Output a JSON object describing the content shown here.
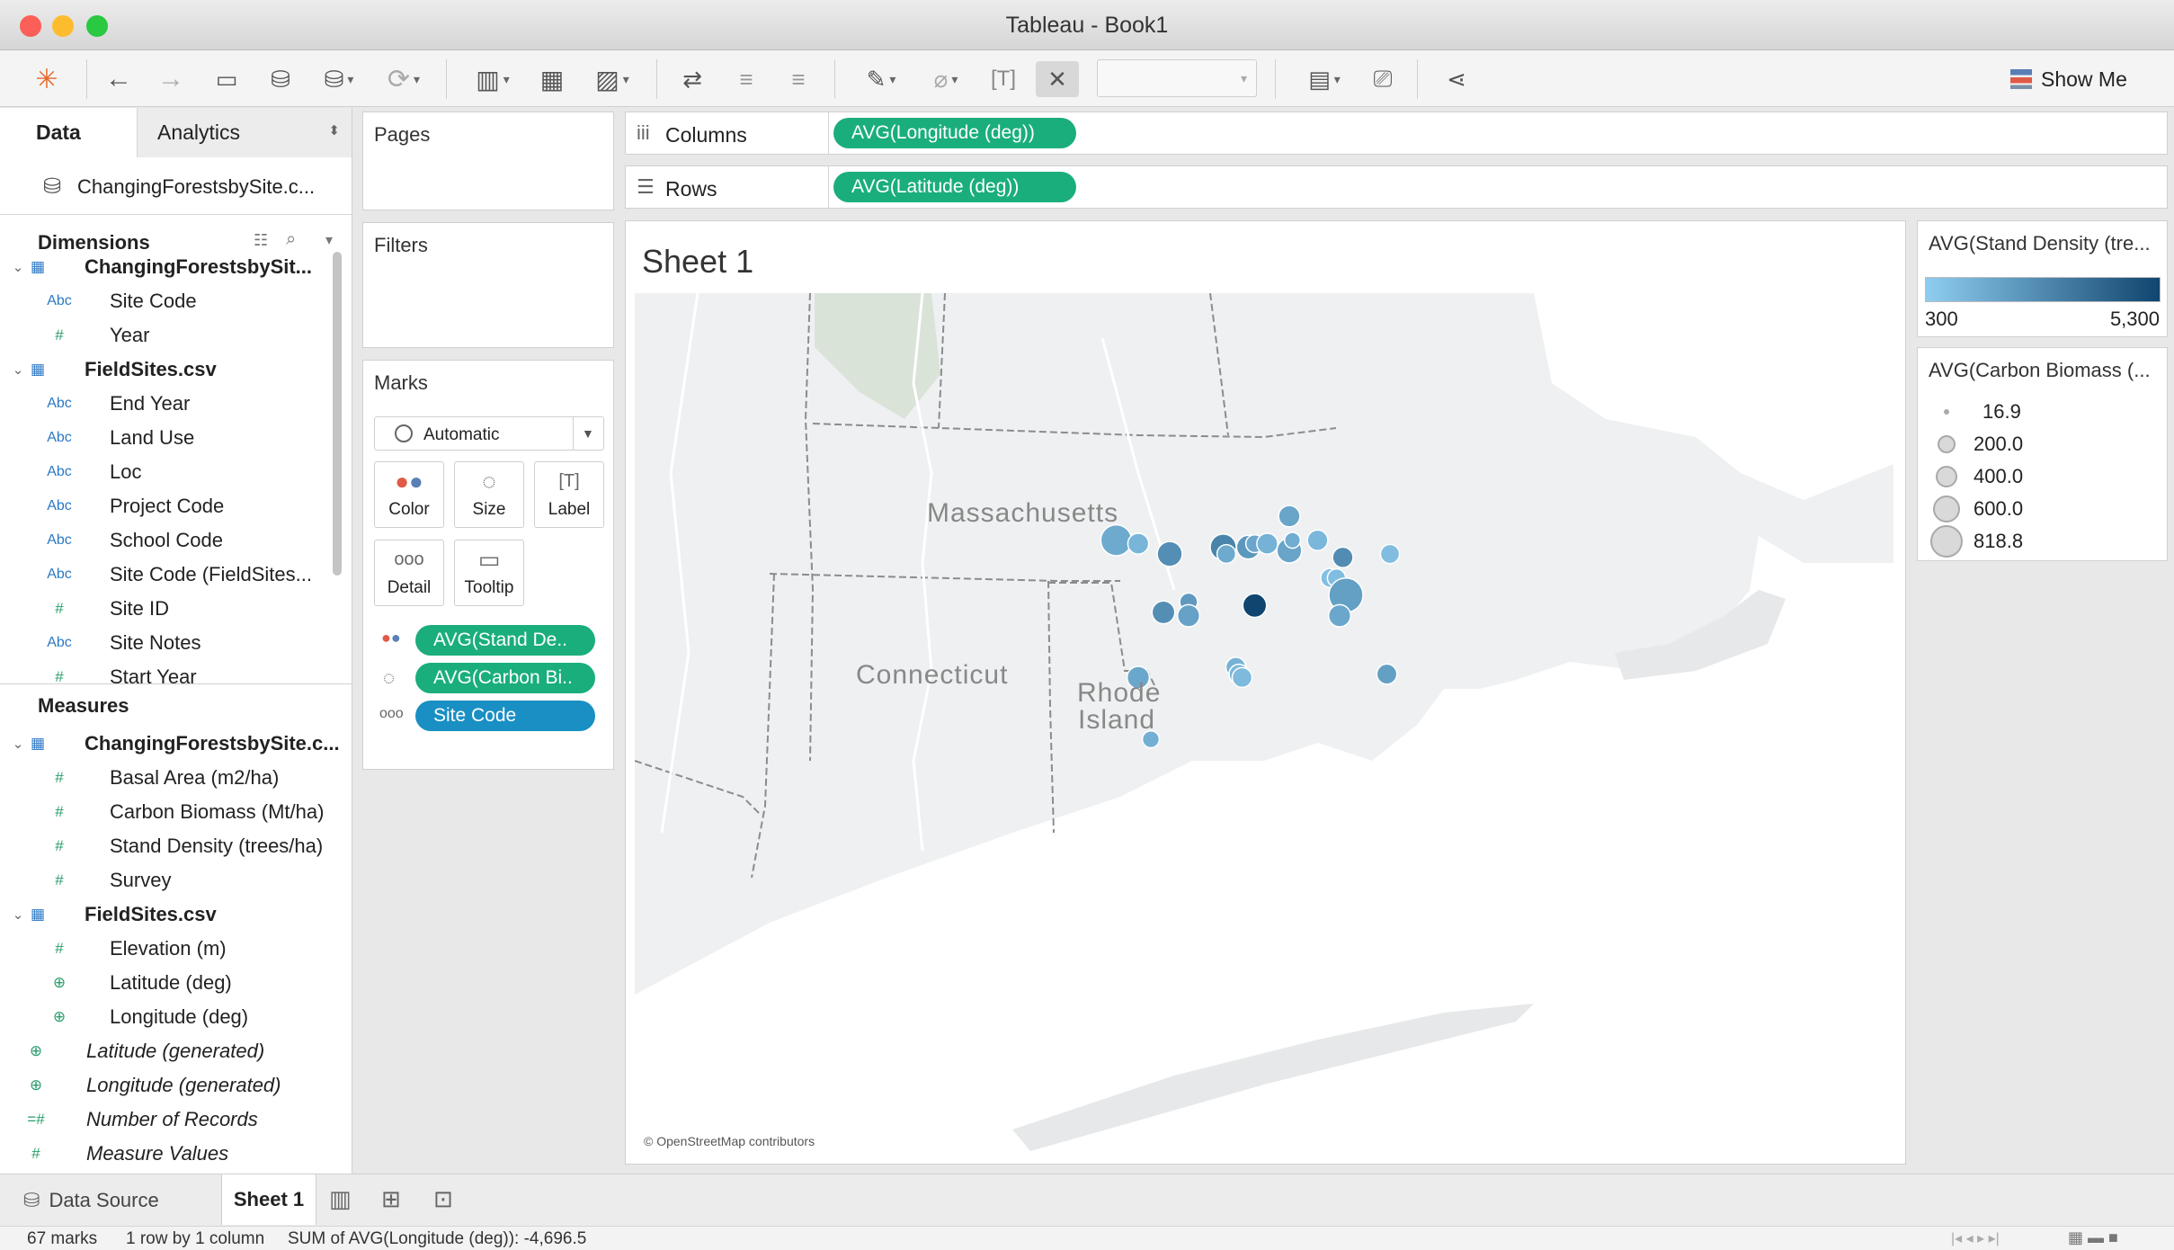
{
  "window": {
    "title": "Tableau - Book1"
  },
  "toolbar": {
    "show_me": "Show Me"
  },
  "data_pane": {
    "tab_data": "Data",
    "tab_analytics": "Analytics",
    "datasource": "ChangingForestsbySite.c...",
    "dimensions_header": "Dimensions",
    "measures_header": "Measures",
    "dimensions": [
      {
        "label": "ChangingForestsbySit...",
        "type": "table",
        "level": 0
      },
      {
        "label": "Site Code",
        "type": "Abc",
        "level": 1
      },
      {
        "label": "Year",
        "type": "#",
        "level": 1
      },
      {
        "label": "FieldSites.csv",
        "type": "table",
        "level": 0
      },
      {
        "label": "End Year",
        "type": "Abc",
        "level": 1
      },
      {
        "label": "Land Use",
        "type": "Abc",
        "level": 1
      },
      {
        "label": "Loc",
        "type": "Abc",
        "level": 1
      },
      {
        "label": "Project Code",
        "type": "Abc",
        "level": 1
      },
      {
        "label": "School Code",
        "type": "Abc",
        "level": 1
      },
      {
        "label": "Site Code (FieldSites...",
        "type": "Abc",
        "level": 1
      },
      {
        "label": "Site ID",
        "type": "#",
        "level": 1
      },
      {
        "label": "Site Notes",
        "type": "Abc",
        "level": 1
      },
      {
        "label": "Start Year",
        "type": "#",
        "level": 1
      }
    ],
    "measures": [
      {
        "label": "ChangingForestsbySite.c...",
        "type": "table",
        "level": 0
      },
      {
        "label": "Basal Area (m2/ha)",
        "type": "#",
        "level": 1
      },
      {
        "label": "Carbon Biomass (Mt/ha)",
        "type": "#",
        "level": 1
      },
      {
        "label": "Stand Density (trees/ha)",
        "type": "#",
        "level": 1
      },
      {
        "label": "Survey",
        "type": "#",
        "level": 1
      },
      {
        "label": "FieldSites.csv",
        "type": "table",
        "level": 0
      },
      {
        "label": "Elevation (m)",
        "type": "#",
        "level": 1
      },
      {
        "label": "Latitude (deg)",
        "type": "geo",
        "level": 1
      },
      {
        "label": "Longitude (deg)",
        "type": "geo",
        "level": 1
      },
      {
        "label": "Latitude (generated)",
        "type": "geo",
        "level": 2
      },
      {
        "label": "Longitude (generated)",
        "type": "geo",
        "level": 2
      },
      {
        "label": "Number of Records",
        "type": "=#",
        "level": 2
      },
      {
        "label": "Measure Values",
        "type": "#",
        "level": 2
      }
    ]
  },
  "cards": {
    "pages": "Pages",
    "filters": "Filters",
    "marks": "Marks",
    "mark_type": "Automatic",
    "mark_buttons": [
      "Color",
      "Size",
      "Label",
      "Detail",
      "Tooltip"
    ],
    "mark_pills": [
      "AVG(Stand De..",
      "AVG(Carbon Bi..",
      "Site Code"
    ]
  },
  "shelves": {
    "columns_label": "Columns",
    "rows_label": "Rows",
    "columns_pill": "AVG(Longitude (deg))",
    "rows_pill": "AVG(Latitude (deg))"
  },
  "sheet": {
    "title": "Sheet 1",
    "map_labels": [
      "Massachusetts",
      "Connecticut",
      "Rhode",
      "Island"
    ],
    "attribution": "© OpenStreetMap contributors"
  },
  "legends": {
    "color_title": "AVG(Stand Density (tre...",
    "color_min": "300",
    "color_max": "5,300",
    "color_range": [
      "#8fcdf0",
      "#10456f"
    ],
    "size_title": "AVG(Carbon Biomass (...",
    "size_items": [
      "16.9",
      "200.0",
      "400.0",
      "600.0",
      "818.8"
    ]
  },
  "map_marks": [
    {
      "lon": -72.17,
      "lat": 42.53,
      "biomass": 620,
      "density": 1600
    },
    {
      "lon": -72.1,
      "lat": 42.52,
      "biomass": 180,
      "density": 1200
    },
    {
      "lon": -72.0,
      "lat": 42.49,
      "biomass": 330,
      "density": 2600
    },
    {
      "lon": -71.83,
      "lat": 42.51,
      "biomass": 380,
      "density": 3000
    },
    {
      "lon": -71.82,
      "lat": 42.49,
      "biomass": 120,
      "density": 1600
    },
    {
      "lon": -71.75,
      "lat": 42.51,
      "biomass": 280,
      "density": 2300
    },
    {
      "lon": -71.73,
      "lat": 42.52,
      "biomass": 100,
      "density": 1700
    },
    {
      "lon": -71.69,
      "lat": 42.52,
      "biomass": 180,
      "density": 1300
    },
    {
      "lon": -71.62,
      "lat": 42.5,
      "biomass": 320,
      "density": 1800
    },
    {
      "lon": -71.61,
      "lat": 42.53,
      "biomass": 60,
      "density": 1500
    },
    {
      "lon": -71.62,
      "lat": 42.6,
      "biomass": 200,
      "density": 1800
    },
    {
      "lon": -71.53,
      "lat": 42.53,
      "biomass": 170,
      "density": 1100
    },
    {
      "lon": -71.45,
      "lat": 42.48,
      "biomass": 170,
      "density": 2700
    },
    {
      "lon": -71.3,
      "lat": 42.49,
      "biomass": 130,
      "density": 900
    },
    {
      "lon": -71.49,
      "lat": 42.42,
      "biomass": 130,
      "density": 800
    },
    {
      "lon": -71.47,
      "lat": 42.42,
      "biomass": 110,
      "density": 900
    },
    {
      "lon": -71.44,
      "lat": 42.37,
      "biomass": 818,
      "density": 2000
    },
    {
      "lon": -71.46,
      "lat": 42.31,
      "biomass": 220,
      "density": 1700
    },
    {
      "lon": -71.73,
      "lat": 42.34,
      "biomass": 280,
      "density": 5300
    },
    {
      "lon": -71.94,
      "lat": 42.35,
      "biomass": 100,
      "density": 2200
    },
    {
      "lon": -71.94,
      "lat": 42.31,
      "biomass": 220,
      "density": 1900
    },
    {
      "lon": -72.02,
      "lat": 42.32,
      "biomass": 250,
      "density": 2600
    },
    {
      "lon": -71.79,
      "lat": 42.16,
      "biomass": 150,
      "density": 1300
    },
    {
      "lon": -71.78,
      "lat": 42.14,
      "biomass": 150,
      "density": 1100
    },
    {
      "lon": -71.77,
      "lat": 42.13,
      "biomass": 150,
      "density": 1000
    },
    {
      "lon": -72.1,
      "lat": 42.13,
      "biomass": 230,
      "density": 1700
    },
    {
      "lon": -71.31,
      "lat": 42.14,
      "biomass": 160,
      "density": 2000
    },
    {
      "lon": -72.06,
      "lat": 41.95,
      "biomass": 80,
      "density": 1400
    }
  ],
  "bottom_tabs": {
    "data_source": "Data Source",
    "sheet1": "Sheet 1"
  },
  "status": {
    "marks": "67 marks",
    "dims": "1 row by 1 column",
    "sum": "SUM of AVG(Longitude (deg)): -4,696.5"
  }
}
